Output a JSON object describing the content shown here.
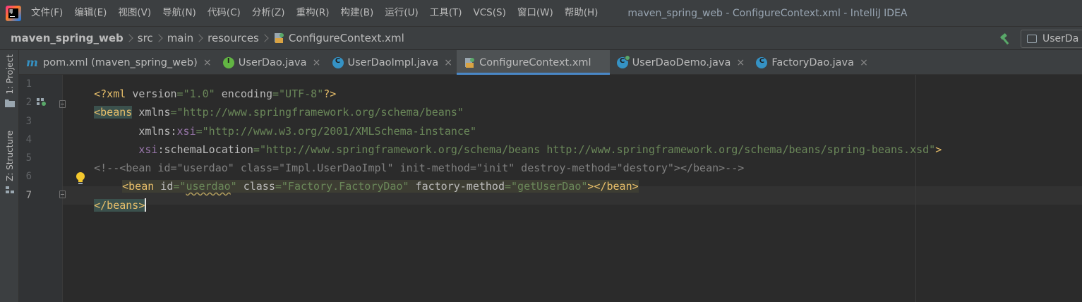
{
  "menu": {
    "items": [
      "文件(F)",
      "编辑(E)",
      "视图(V)",
      "导航(N)",
      "代码(C)",
      "分析(Z)",
      "重构(R)",
      "构建(B)",
      "运行(U)",
      "工具(T)",
      "VCS(S)",
      "窗口(W)",
      "帮助(H)"
    ],
    "window_title": "maven_spring_web - ConfigureContext.xml - IntelliJ IDEA"
  },
  "breadcrumb": {
    "items": [
      "maven_spring_web",
      "src",
      "main",
      "resources",
      "ConfigureContext.xml"
    ]
  },
  "run_config": {
    "label": "UserDa"
  },
  "tool_strip": {
    "project_label": "1: Project",
    "structure_label": "Z: Structure"
  },
  "tabs": [
    {
      "label": "pom.xml (maven_spring_web)",
      "icon": "maven-icon",
      "active": false
    },
    {
      "label": "UserDao.java",
      "icon": "interface-icon",
      "active": false
    },
    {
      "label": "UserDaoImpl.java",
      "icon": "class-icon",
      "active": false
    },
    {
      "label": "ConfigureContext.xml",
      "icon": "spring-xml-icon",
      "active": true
    },
    {
      "label": "UserDaoDemo.java",
      "icon": "runnable-class-icon",
      "active": false
    },
    {
      "label": "FactoryDao.java",
      "icon": "class-icon",
      "active": false
    }
  ],
  "tab_close_glyph": "×",
  "editor": {
    "line_numbers": [
      "1",
      "2",
      "3",
      "4",
      "5",
      "6",
      "7"
    ],
    "current_line": "7",
    "code": {
      "l1": {
        "open": "<?xml ",
        "a1": "version",
        "eq1": "=",
        "v1": "\"1.0\"",
        "sp": " ",
        "a2": "encoding",
        "eq2": "=",
        "v2": "\"UTF-8\"",
        "close": "?>"
      },
      "l2": {
        "tag": "<beans",
        "sp": " ",
        "attr": "xmlns",
        "eq": "=",
        "val": "\"http://www.springframework.org/schema/beans\""
      },
      "l3": {
        "indent": "       ",
        "attr": "xmlns:",
        "ns": "xsi",
        "eq": "=",
        "val": "\"http://www.w3.org/2001/XMLSchema-instance\""
      },
      "l4": {
        "indent": "       ",
        "ns": "xsi",
        "attr": ":schemaLocation",
        "eq": "=",
        "val": "\"http://www.springframework.org/schema/beans http://www.springframework.org/schema/beans/spring-beans.xsd\"",
        "close": ">"
      },
      "l5": {
        "comment": "<!--<bean id=\"userdao\" class=\"Impl.UserDaoImpl\" init-method=\"init\" destroy-method=\"destory\"></bean>-->"
      },
      "l6": {
        "tag": "<bean",
        "a1": " id",
        "eq1": "=",
        "q1": "\"",
        "v1": "userdao",
        "q1b": "\"",
        "a2": " class",
        "eq2": "=",
        "v2": "\"Factory.FactoryDao\"",
        "a3": " factory-method",
        "eq3": "=",
        "v3": "\"getUserDao\"",
        "close": "></bean>"
      },
      "l7": {
        "tag": "</beans>"
      }
    }
  },
  "colors": {
    "tag": "#e8bf6a",
    "attribute": "#bababa",
    "namespace": "#9876aa",
    "value": "#6a8759",
    "comment": "#808080",
    "active_tab_underline": "#4a88c7"
  }
}
